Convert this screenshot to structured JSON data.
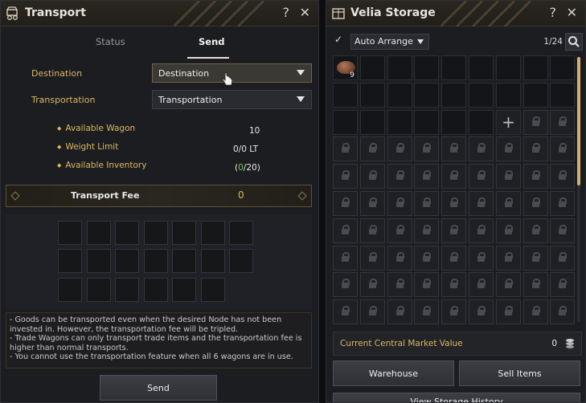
{
  "transport": {
    "title": "Transport",
    "tabs": [
      {
        "label": "Status"
      },
      {
        "label": "Send"
      }
    ],
    "destination": {
      "label": "Destination",
      "value": "Destination"
    },
    "transportation": {
      "label": "Transportation",
      "value": "Transportation"
    },
    "stats": [
      {
        "label": "Available Wagon",
        "value": "10"
      },
      {
        "label": "Weight Limit",
        "value": "0/0 LT"
      },
      {
        "label": "Available Inventory",
        "open": "(",
        "current": "0",
        "rest": "/20)"
      }
    ],
    "fee": {
      "label": "Transport Fee",
      "value": "0"
    },
    "notes": [
      "- Goods can be transported even when the desired Node has not been invested in. However, the transportation fee will be tripled.",
      "- Trade Wagons can only transport trade items and the transportation fee is higher than normal transports.",
      "- You cannot use the transportation feature when all 6 wagons are in use."
    ],
    "send_label": "Send"
  },
  "storage": {
    "title": "Velia Storage",
    "auto_arrange": "Auto Arrange",
    "capacity": "1/24",
    "item_qty": "9",
    "market_label": "Current Central Market Value",
    "market_value": "0",
    "warehouse_label": "Warehouse",
    "sell_label": "Sell Items",
    "history_label": "View Storage History"
  },
  "colors": {
    "accent": "#d9b861",
    "green": "#6fd14a"
  }
}
